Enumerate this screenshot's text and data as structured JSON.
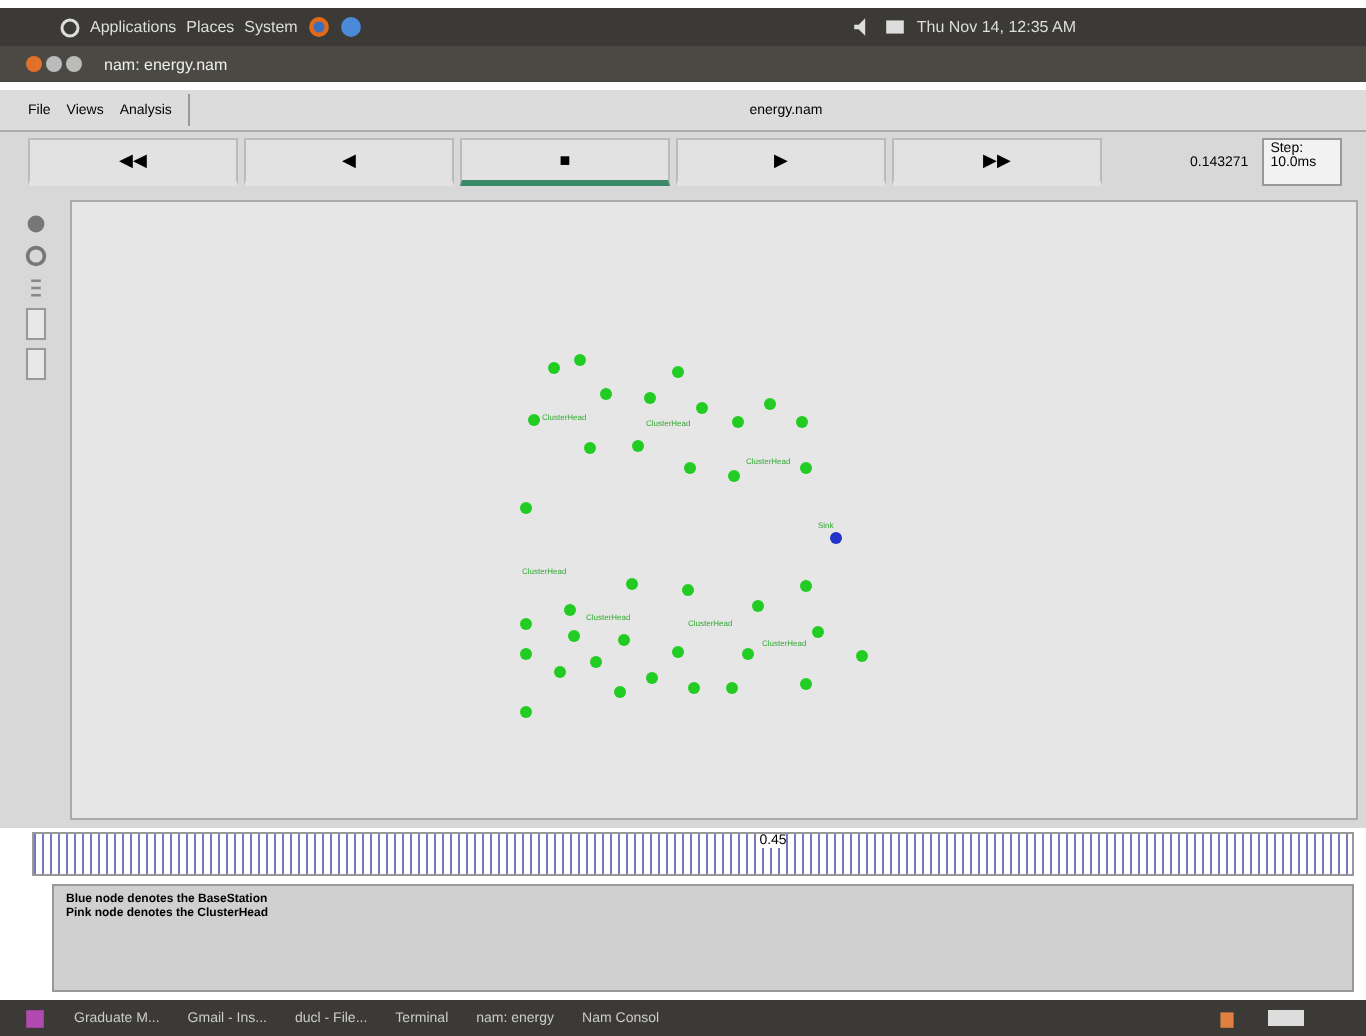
{
  "top_panel": {
    "menus": [
      "Applications",
      "Places",
      "System"
    ],
    "clock": "Thu Nov 14, 12:35 AM"
  },
  "window": {
    "title": "nam: energy.nam"
  },
  "menu_bar": {
    "items": [
      "File",
      "Views",
      "Analysis"
    ],
    "file_name": "energy.nam"
  },
  "controls": [
    {
      "symbol": "◀◀",
      "selected": false
    },
    {
      "symbol": "◀",
      "selected": false
    },
    {
      "symbol": "■",
      "selected": true
    },
    {
      "symbol": "▶",
      "selected": false
    },
    {
      "symbol": "▶▶",
      "selected": false
    }
  ],
  "time": "0.143271",
  "step": "Step: 10.0ms",
  "nodes": [
    {
      "color": "#22cc22"
    },
    {
      "color": "#22cc22"
    },
    {
      "color": "#22cc22"
    },
    {
      "color": "#22cc22"
    },
    {
      "color": "#22cc22"
    },
    {
      "color": "#22cc22"
    },
    {
      "color": "#22cc22"
    },
    {
      "color": "#22cc22"
    },
    {
      "color": "#22cc22"
    },
    {
      "color": "#22cc22"
    },
    {
      "color": "#22cc22"
    },
    {
      "color": "#22cc22"
    },
    {
      "color": "#22cc22"
    },
    {
      "color": "#22cc22"
    },
    {
      "color": "#22cc22"
    },
    {
      "color": "#22cc22"
    },
    {
      "color": "#2233cc"
    },
    {
      "color": "#22cc22"
    },
    {
      "color": "#22cc22"
    },
    {
      "color": "#22cc22"
    },
    {
      "color": "#22cc22"
    },
    {
      "color": "#22cc22"
    },
    {
      "color": "#22cc22"
    },
    {
      "color": "#22cc22"
    },
    {
      "color": "#22cc22"
    },
    {
      "color": "#22cc22"
    },
    {
      "color": "#22cc22"
    },
    {
      "color": "#22cc22"
    },
    {
      "color": "#22cc22"
    },
    {
      "color": "#22cc22"
    },
    {
      "color": "#22cc22"
    },
    {
      "color": "#22cc22"
    },
    {
      "color": "#22cc22"
    },
    {
      "color": "#22cc22"
    },
    {
      "color": "#22cc22"
    },
    {
      "color": "#22cc22"
    },
    {
      "color": "#22cc22"
    },
    {
      "color": "#22cc22"
    }
  ],
  "node_labels": [
    "ClusterHead",
    "ClusterHead",
    "ClusterHead",
    "Sink",
    "ClusterHead",
    "ClusterHead",
    "ClusterHead",
    "ClusterHead"
  ],
  "timeline": {
    "label": "0.45"
  },
  "messages": [
    "Blue node denotes the BaseStation",
    "Pink node denotes the ClusterHead"
  ],
  "taskbar": [
    "Graduate M...",
    "Gmail - Ins...",
    "ducl - File...",
    "Terminal",
    "nam: energy",
    "Nam Consol"
  ]
}
